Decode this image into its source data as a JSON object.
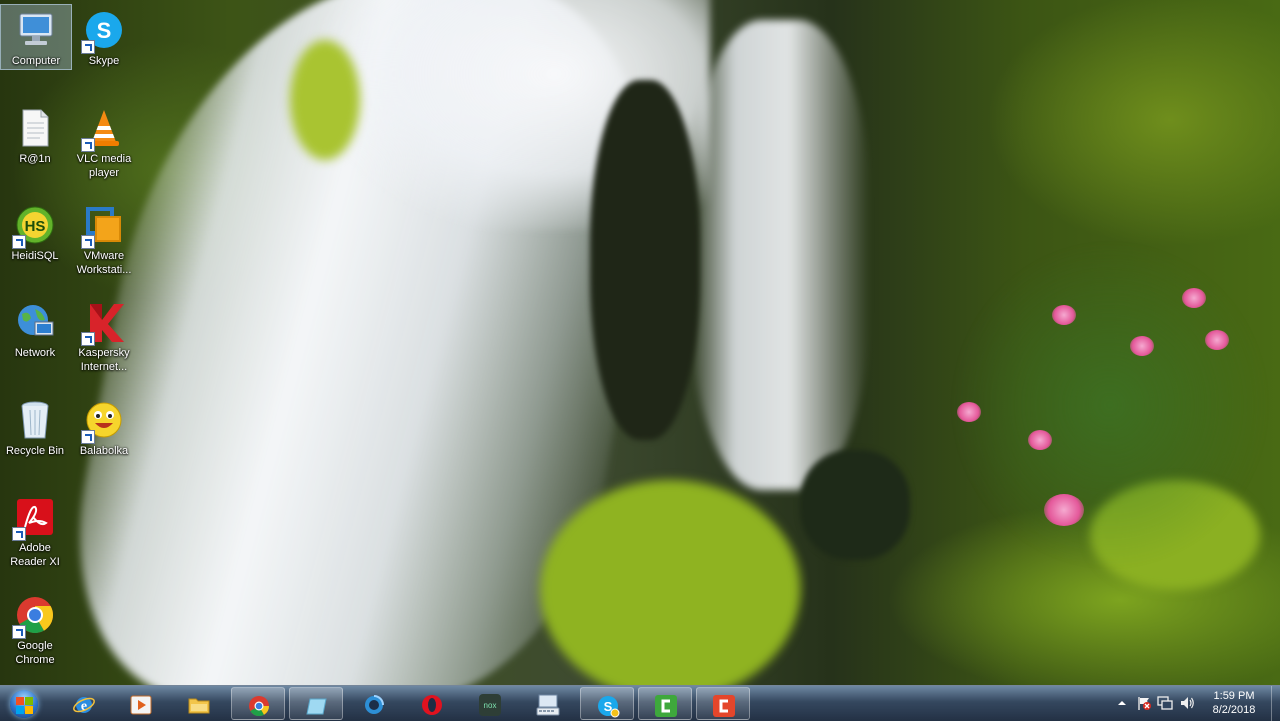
{
  "desktop": {
    "icons": [
      {
        "label": "Computer",
        "icon": "computer-icon"
      },
      {
        "label": "Skype",
        "icon": "skype-icon"
      },
      {
        "label": "R@1n",
        "icon": "text-file-icon"
      },
      {
        "label": "VLC media player",
        "icon": "vlc-icon"
      },
      {
        "label": "HeidiSQL",
        "icon": "heidisql-icon"
      },
      {
        "label": "VMware Workstati...",
        "icon": "vmware-icon"
      },
      {
        "label": "Network",
        "icon": "network-icon"
      },
      {
        "label": "Kaspersky Internet...",
        "icon": "kaspersky-icon"
      },
      {
        "label": "Recycle Bin",
        "icon": "recycle-bin-icon"
      },
      {
        "label": "Balabolka",
        "icon": "balabolka-icon"
      },
      {
        "label": "Adobe Reader XI",
        "icon": "adobe-reader-icon"
      },
      {
        "label": "Google Chrome",
        "icon": "chrome-icon"
      }
    ],
    "selected_icon": "Computer"
  },
  "taskbar": {
    "pinned": [
      {
        "icon": "internet-explorer-icon"
      },
      {
        "icon": "media-player-icon"
      },
      {
        "icon": "file-explorer-icon"
      },
      {
        "icon": "chrome-icon",
        "open": true
      },
      {
        "icon": "blank-window-icon",
        "open": true
      },
      {
        "icon": "app-circle-icon"
      },
      {
        "icon": "opera-icon"
      },
      {
        "icon": "nox-icon"
      },
      {
        "icon": "keyboard-icon"
      },
      {
        "icon": "skype-icon",
        "open": true
      },
      {
        "icon": "camtasia-green-icon",
        "open": true
      },
      {
        "icon": "camtasia-red-icon",
        "open": true
      }
    ],
    "tray": {
      "icons": [
        "show-hidden-icons-icon",
        "action-center-flag-icon",
        "network-icon",
        "volume-icon"
      ],
      "nox_label": "nox",
      "time": "1:59 PM",
      "date": "8/2/2018"
    }
  },
  "colors": {
    "taskbar": "#2a3c55",
    "icon_label": "#ffffff",
    "selection": "#bed7f5"
  }
}
